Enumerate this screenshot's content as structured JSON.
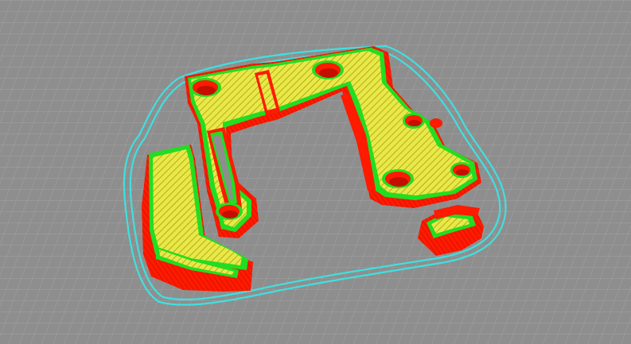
{
  "viewport": {
    "label": "",
    "colors": {
      "background": "#8e8e8e",
      "grid_line": "#a3a3a3",
      "skirt": "#3fe0e0",
      "wall": "#ff1a00",
      "wall_shade": "#c40f00",
      "infill": "#e8e84a",
      "infill_hatch": "#a8a000",
      "perimeter": "#22dd22"
    },
    "legend": []
  }
}
